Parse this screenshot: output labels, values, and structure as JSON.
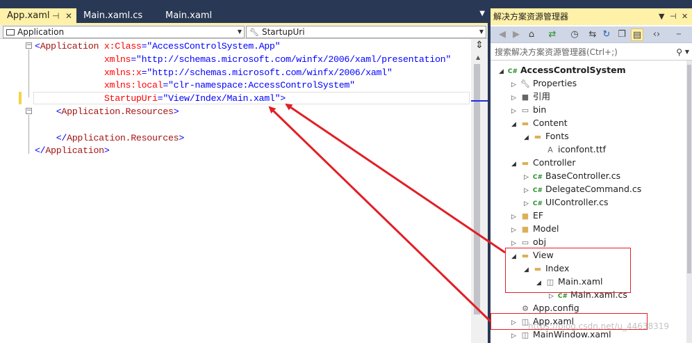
{
  "editor": {
    "tabs": [
      {
        "label": "App.xaml",
        "active": true
      },
      {
        "label": "Main.xaml.cs",
        "active": false
      },
      {
        "label": "Main.xaml",
        "active": false
      }
    ],
    "pin_icon": "pin-icon",
    "close_icon": "close-icon",
    "nav": {
      "left_combo": "Application",
      "right_combo": "StartupUri"
    },
    "code": [
      [
        {
          "t": "<",
          "c": "c-blue"
        },
        {
          "t": "Application",
          "c": "c-brown"
        },
        {
          "t": " x:Class",
          "c": "c-red"
        },
        {
          "t": "=",
          "c": "c-blue"
        },
        {
          "t": "\"AccessControlSystem.App\"",
          "c": "c-blue"
        }
      ],
      [
        {
          "t": "             xmlns",
          "c": "c-red"
        },
        {
          "t": "=",
          "c": "c-blue"
        },
        {
          "t": "\"http://schemas.microsoft.com/winfx/2006/xaml/presentation\"",
          "c": "c-blue"
        }
      ],
      [
        {
          "t": "             xmlns:x",
          "c": "c-red"
        },
        {
          "t": "=",
          "c": "c-blue"
        },
        {
          "t": "\"http://schemas.microsoft.com/winfx/2006/xaml\"",
          "c": "c-blue"
        }
      ],
      [
        {
          "t": "             xmlns:local",
          "c": "c-red"
        },
        {
          "t": "=",
          "c": "c-blue"
        },
        {
          "t": "\"clr-namespace:AccessControlSystem\"",
          "c": "c-blue"
        }
      ],
      [
        {
          "t": "             StartupUri",
          "c": "c-red"
        },
        {
          "t": "=",
          "c": "c-blue"
        },
        {
          "t": "\"View/Index/Main.xaml\"",
          "c": "c-blue"
        },
        {
          "t": ">",
          "c": "c-blue"
        }
      ],
      [
        {
          "t": "    <",
          "c": "c-blue"
        },
        {
          "t": "Application.Resources",
          "c": "c-brown"
        },
        {
          "t": ">",
          "c": "c-blue"
        }
      ],
      [
        {
          "t": "",
          "c": "c-black"
        }
      ],
      [
        {
          "t": "    </",
          "c": "c-blue"
        },
        {
          "t": "Application.Resources",
          "c": "c-brown"
        },
        {
          "t": ">",
          "c": "c-blue"
        }
      ],
      [
        {
          "t": "</",
          "c": "c-blue"
        },
        {
          "t": "Application",
          "c": "c-brown"
        },
        {
          "t": ">",
          "c": "c-blue"
        }
      ]
    ]
  },
  "solution_explorer": {
    "title": "解决方案资源管理器",
    "search_placeholder": "搜索解决方案资源管理器(Ctrl+;)",
    "toolbar_icons": [
      "back-icon",
      "forward-icon",
      "home-icon",
      "sync-icon",
      "history-icon",
      "switch-views-icon",
      "refresh-icon",
      "collapse-all-icon",
      "show-all-files-icon",
      "view-code-icon"
    ],
    "tree": [
      {
        "label": "AccessControlSystem",
        "depth": 0,
        "expander": "open",
        "icon": "csharp-project-icon",
        "bold": true
      },
      {
        "label": "Properties",
        "depth": 1,
        "expander": "closed",
        "icon": "wrench-icon"
      },
      {
        "label": "引用",
        "depth": 1,
        "expander": "closed",
        "icon": "references-icon"
      },
      {
        "label": "bin",
        "depth": 1,
        "expander": "closed",
        "icon": "folder-dotted-icon"
      },
      {
        "label": "Content",
        "depth": 1,
        "expander": "open",
        "icon": "folder-open-icon"
      },
      {
        "label": "Fonts",
        "depth": 2,
        "expander": "open",
        "icon": "folder-open-icon"
      },
      {
        "label": "iconfont.ttf",
        "depth": 3,
        "expander": "none",
        "icon": "font-file-icon"
      },
      {
        "label": "Controller",
        "depth": 1,
        "expander": "open",
        "icon": "folder-open-icon"
      },
      {
        "label": "BaseController.cs",
        "depth": 2,
        "expander": "closed",
        "icon": "csharp-file-icon"
      },
      {
        "label": "DelegateCommand.cs",
        "depth": 2,
        "expander": "closed",
        "icon": "csharp-file-icon"
      },
      {
        "label": "UIController.cs",
        "depth": 2,
        "expander": "closed",
        "icon": "csharp-file-icon"
      },
      {
        "label": "EF",
        "depth": 1,
        "expander": "closed",
        "icon": "folder-icon"
      },
      {
        "label": "Model",
        "depth": 1,
        "expander": "closed",
        "icon": "folder-icon"
      },
      {
        "label": "obj",
        "depth": 1,
        "expander": "closed",
        "icon": "folder-dotted-icon"
      },
      {
        "label": "View",
        "depth": 1,
        "expander": "open",
        "icon": "folder-open-icon"
      },
      {
        "label": "Index",
        "depth": 2,
        "expander": "open",
        "icon": "folder-open-icon"
      },
      {
        "label": "Main.xaml",
        "depth": 3,
        "expander": "open",
        "icon": "xaml-file-icon"
      },
      {
        "label": "Main.xaml.cs",
        "depth": 4,
        "expander": "closed",
        "icon": "csharp-file-icon"
      },
      {
        "label": "App.config",
        "depth": 1,
        "expander": "none",
        "icon": "config-file-icon"
      },
      {
        "label": "App.xaml",
        "depth": 1,
        "expander": "closed",
        "icon": "xaml-file-icon"
      },
      {
        "label": "MainWindow.xaml",
        "depth": 1,
        "expander": "closed",
        "icon": "xaml-file-icon"
      }
    ]
  },
  "watermark": "https://blog.csdn.net/u_44638319",
  "colors": {
    "vs_dark": "#293955",
    "tab_active": "#fff1a8",
    "annotation_red": "#e21f26",
    "marker_blue": "#1c2edd"
  }
}
